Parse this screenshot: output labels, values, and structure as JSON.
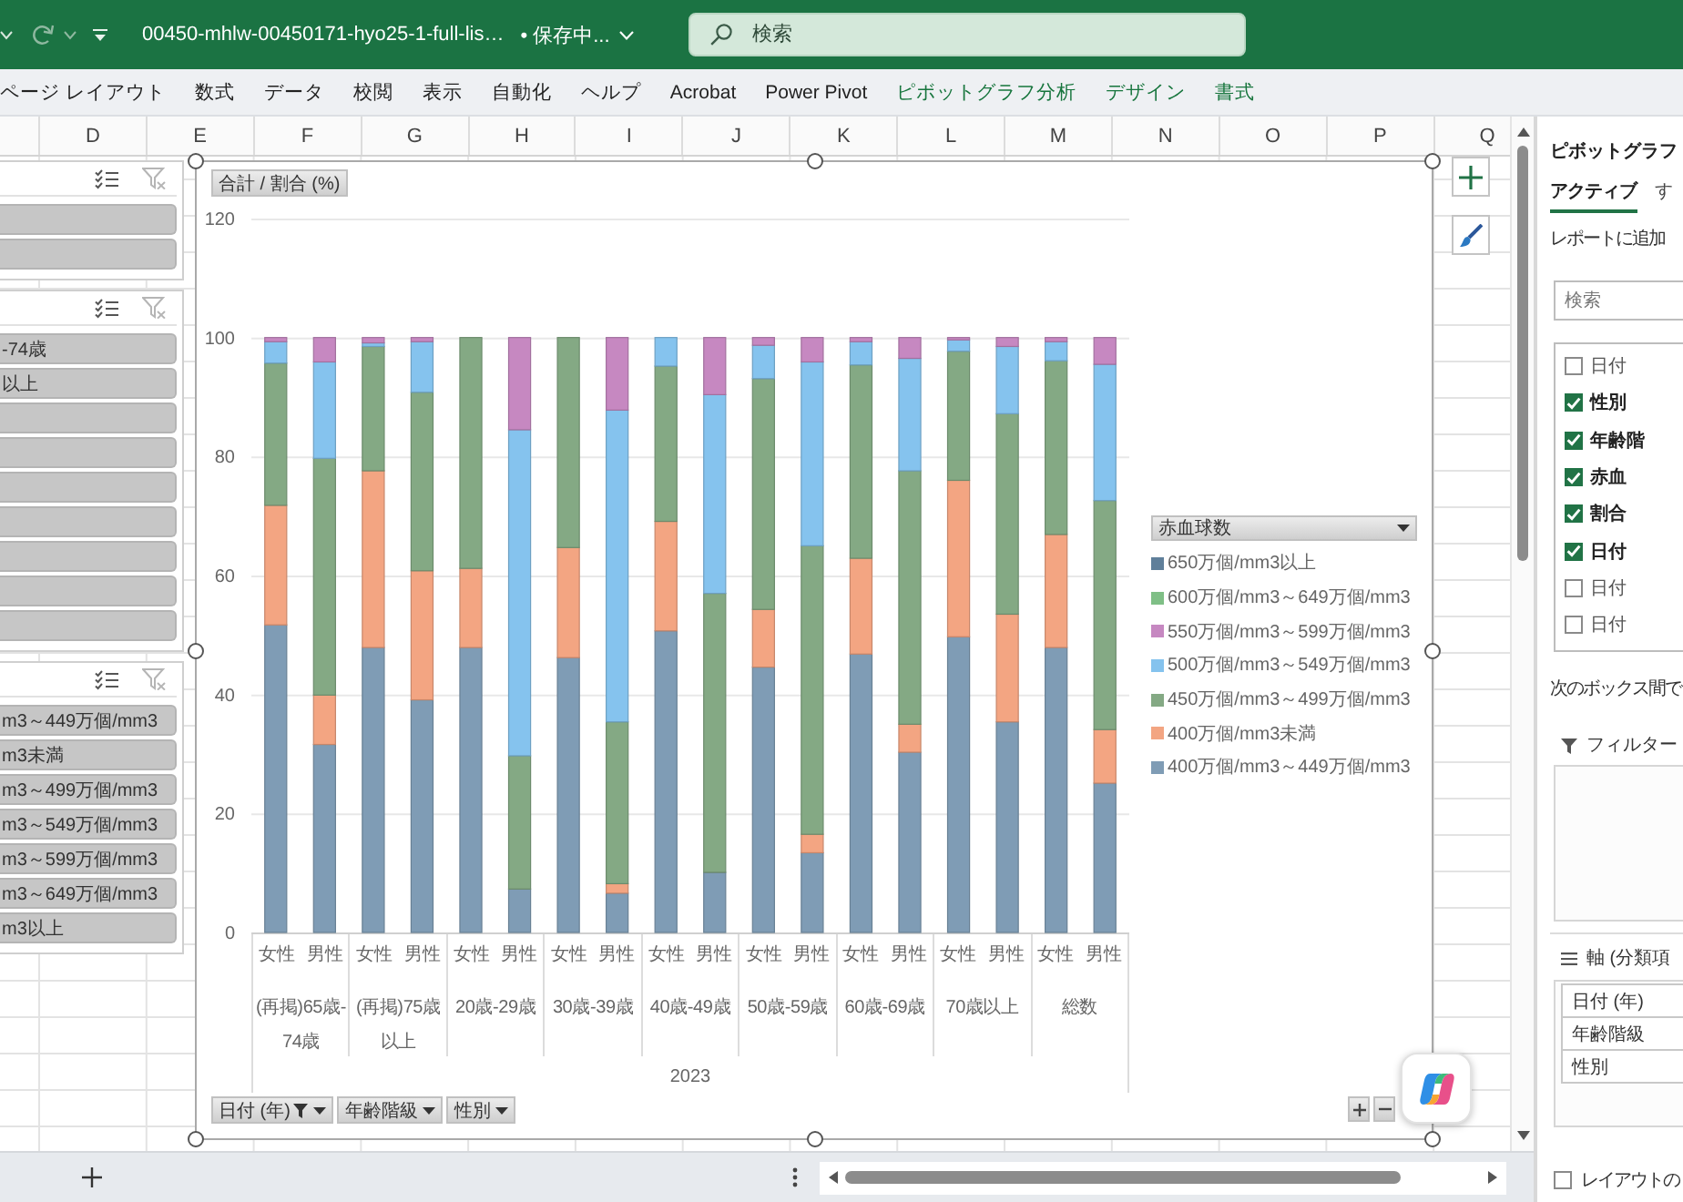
{
  "title_bar": {
    "file_name": "00450-mhlw-00450171-hyo25-1-full-lis…",
    "save_status": "• 保存中...",
    "search": {
      "placeholder": "検索"
    }
  },
  "ribbon_tabs": [
    {
      "label": "ページ レイアウト",
      "contextual": false
    },
    {
      "label": "数式",
      "contextual": false
    },
    {
      "label": "データ",
      "contextual": false
    },
    {
      "label": "校閲",
      "contextual": false
    },
    {
      "label": "表示",
      "contextual": false
    },
    {
      "label": "自動化",
      "contextual": false
    },
    {
      "label": "ヘルプ",
      "contextual": false
    },
    {
      "label": "Acrobat",
      "contextual": false
    },
    {
      "label": "Power Pivot",
      "contextual": false
    },
    {
      "label": "ピボットグラフ分析",
      "contextual": true
    },
    {
      "label": "デザイン",
      "contextual": true
    },
    {
      "label": "書式",
      "contextual": true
    }
  ],
  "column_headers": [
    "D",
    "E",
    "F",
    "G",
    "H",
    "I",
    "J",
    "K",
    "L",
    "M",
    "N",
    "O",
    "P",
    "Q"
  ],
  "slicers": [
    {
      "items": [
        {
          "selected": true
        },
        {
          "selected": true
        }
      ]
    },
    {
      "items": [
        {
          "label": "-74歳",
          "selected": true
        },
        {
          "label": "以上",
          "selected": true
        },
        {
          "selected": true
        },
        {
          "selected": true
        },
        {
          "selected": true
        },
        {
          "selected": true
        },
        {
          "selected": true
        },
        {
          "selected": true
        },
        {
          "selected": true
        }
      ]
    },
    {
      "items": [
        {
          "label": "m3～449万個/mm3",
          "selected": true
        },
        {
          "label": "m3未満",
          "selected": true
        },
        {
          "label": "m3～499万個/mm3",
          "selected": true
        },
        {
          "label": "m3～549万個/mm3",
          "selected": true
        },
        {
          "label": "m3～599万個/mm3",
          "selected": true
        },
        {
          "label": "m3～649万個/mm3",
          "selected": true
        },
        {
          "label": "m3以上",
          "selected": true
        }
      ]
    }
  ],
  "pivot_chart": {
    "value_field_button": "合計 / 割合 (%)",
    "legend_field_button": "赤血球数",
    "axis_groups": [
      "(再掲)65歳-74歳",
      "(再掲)75歳以上",
      "20歳-29歳",
      "30歳-39歳",
      "40歳-49歳",
      "50歳-59歳",
      "60歳-69歳",
      "70歳以上",
      "総数"
    ],
    "axis_year": "2023",
    "axis_field_buttons": [
      {
        "label": "日付 (年)",
        "filtered": true
      },
      {
        "label": "年齢階級",
        "filtered": false
      },
      {
        "label": "性別",
        "filtered": false
      }
    ],
    "chart_data": {
      "type": "bar",
      "stacked": true,
      "grid": true,
      "legend": "right",
      "categories": [
        "女性",
        "男性",
        "女性",
        "男性",
        "女性",
        "男性",
        "女性",
        "男性",
        "女性",
        "男性",
        "女性",
        "男性",
        "女性",
        "男性",
        "女性",
        "男性",
        "女性",
        "男性"
      ],
      "series": [
        {
          "name": "400万個/mm3～449万個/mm3",
          "color": "#7f9cb5",
          "values": [
            51.7,
            31.6,
            47.9,
            39.1,
            47.9,
            7.3,
            46.2,
            6.6,
            50.7,
            10.1,
            44.6,
            13.4,
            46.8,
            30.3,
            49.7,
            35.4,
            47.9,
            25.1
          ]
        },
        {
          "name": "400万個/mm3未満",
          "color": "#f3a582",
          "values": [
            20.1,
            8.3,
            29.7,
            21.7,
            13.3,
            0,
            18.5,
            1.6,
            18.4,
            0,
            9.7,
            3.1,
            16.1,
            4.7,
            26.3,
            18.1,
            19.0,
            9.0
          ]
        },
        {
          "name": "450万個/mm3～499万個/mm3",
          "color": "#84a984",
          "values": [
            23.9,
            39.8,
            20.9,
            30.0,
            38.8,
            22.4,
            35.3,
            27.2,
            26.1,
            46.9,
            38.8,
            48.5,
            32.5,
            42.6,
            21.7,
            33.7,
            29.2,
            38.5
          ]
        },
        {
          "name": "500万個/mm3～549万個/mm3",
          "color": "#85c3ee",
          "values": [
            3.6,
            16.2,
            0.6,
            8.5,
            0,
            54.8,
            0,
            52.4,
            4.8,
            33.4,
            5.6,
            30.9,
            3.9,
            18.9,
            1.9,
            11.3,
            3.2,
            22.9
          ]
        },
        {
          "name": "550万個/mm3～599万個/mm3",
          "color": "#c688c1",
          "values": [
            0.7,
            4.1,
            0.9,
            0.7,
            0,
            15.5,
            0,
            12.2,
            0,
            9.6,
            1.3,
            4.1,
            0.7,
            3.5,
            0.4,
            1.5,
            0.7,
            4.5
          ]
        },
        {
          "name": "600万個/mm3～649万個/mm3",
          "color": "#7fbf86",
          "values": [
            0,
            0,
            0,
            0,
            0,
            0,
            0,
            0,
            0,
            0,
            0,
            0,
            0,
            0,
            0,
            0,
            0,
            0
          ]
        },
        {
          "name": "650万個/mm3以上",
          "color": "#5f7f9a",
          "values": [
            0,
            0,
            0,
            0,
            0,
            0,
            0,
            0,
            0,
            0,
            0,
            0,
            0,
            0,
            0,
            0,
            0,
            0
          ]
        }
      ],
      "ylim": [
        0,
        120
      ],
      "yticks": [
        0,
        20,
        40,
        60,
        80,
        100,
        120
      ]
    }
  },
  "field_pane": {
    "title": "ピボットグラフ",
    "tabs": [
      {
        "label": "アクティブ",
        "selected": true
      },
      {
        "label": "す",
        "selected": false
      }
    ],
    "instruction": "レポートに追加",
    "search": {
      "placeholder": "検索"
    },
    "fields": [
      {
        "label": "日付",
        "checked": false
      },
      {
        "label": "性別",
        "checked": true
      },
      {
        "label": "年齢階",
        "checked": true
      },
      {
        "label": "赤血",
        "checked": true
      },
      {
        "label": "割合",
        "checked": true
      },
      {
        "label": "日付",
        "checked": true
      },
      {
        "label": "日付",
        "checked": false
      },
      {
        "label": "日付",
        "checked": false
      }
    ],
    "areas_hint": "次のボックス間で",
    "filter_area": {
      "label": "フィルター"
    },
    "axis_area": {
      "label": "軸 (分類項",
      "fields": [
        "日付 (年)",
        "年齢階級",
        "性別"
      ]
    },
    "defer_update": {
      "label": "レイアウトの",
      "checked": false
    }
  }
}
